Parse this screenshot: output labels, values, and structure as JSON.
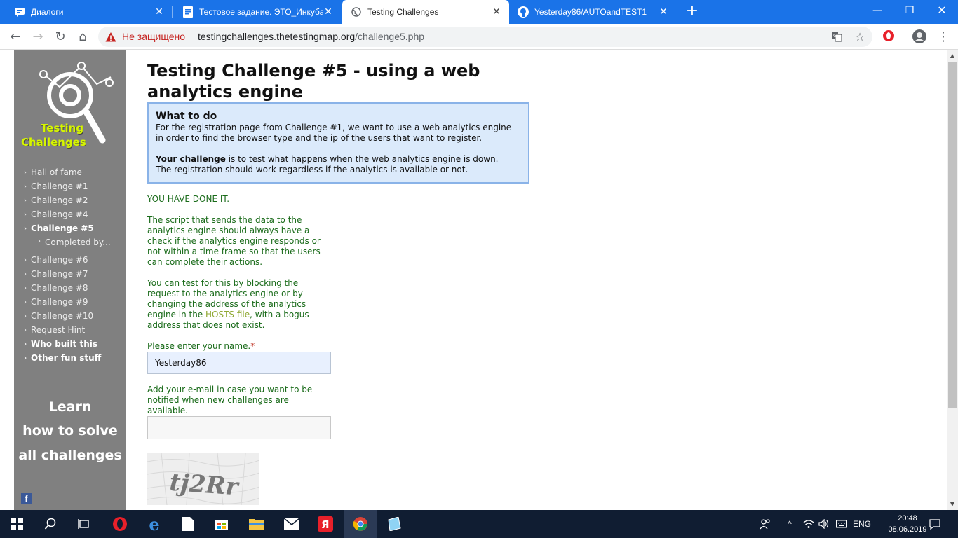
{
  "browser": {
    "tabs": [
      {
        "title": "Диалоги",
        "icon": "vk-chat-icon",
        "active": false
      },
      {
        "title": "Тестовое задание. ЭТО_Инкубатор",
        "icon": "docs-icon",
        "active": false
      },
      {
        "title": "Testing Challenges",
        "icon": "globe-icon",
        "active": true
      },
      {
        "title": "Yesterday86/AUTOandTEST1",
        "icon": "github-icon",
        "active": false
      }
    ],
    "security_label": "Не защищено",
    "url_host": "testingchallenges.thetestingmap.org",
    "url_path": "/challenge5.php"
  },
  "sidebar": {
    "logo_line1": "Testing",
    "logo_line2": "Challenges",
    "menu": [
      {
        "label": "Hall of fame"
      },
      {
        "label": "Challenge #1"
      },
      {
        "label": "Challenge #2"
      },
      {
        "label": "Challenge #4"
      },
      {
        "label": "Challenge #5"
      },
      {
        "label": "Completed by..."
      },
      {
        "label": "Challenge #6"
      },
      {
        "label": "Challenge #7"
      },
      {
        "label": "Challenge #8"
      },
      {
        "label": "Challenge #9"
      },
      {
        "label": "Challenge #10"
      },
      {
        "label": "Request Hint"
      },
      {
        "label": "Who built this"
      },
      {
        "label": "Other fun stuff"
      }
    ],
    "learn": [
      "Learn",
      "how to solve",
      "all challenges"
    ]
  },
  "main": {
    "title": "Testing Challenge #5 - using a web analytics engine",
    "todo": {
      "heading": "What to do",
      "text1": "For the registration page from Challenge #1, we want to use a web analytics engine in order to find the browser type and the ip of the users that want to register.",
      "challenge_strong": "Your challenge",
      "challenge_rest": " is to test what happens when the web analytics engine is down.",
      "text3": "The registration should work regardless if the analytics is available or not."
    },
    "done": "YOU HAVE DONE IT.",
    "para1": "The script that sends the data to the analytics engine should always have a check if the analytics engine responds or not within a time frame so that the users can complete their actions.",
    "para2_before": "You can test for this by blocking the request to the analytics engine or by changing the address of the analytics engine in the ",
    "para2_link": "HOSTS file",
    "para2_after": ", with a bogus address that does not exist.",
    "name_label": "Please enter your name.",
    "name_required": "*",
    "name_value": "Yesterday86",
    "email_label": "Add your e-mail in case you want to be notified when new challenges are available.",
    "email_value": "",
    "captcha_text": "tj2Rr"
  },
  "taskbar": {
    "lang": "ENG",
    "time": "20:48",
    "date": "08.06.2019"
  },
  "colors": {
    "chrome_blue": "#1a73e8",
    "sidebar_gray": "#808080",
    "logo_green": "#d6f500",
    "content_green": "#1a6b1a",
    "box_blue": "#dbeafb",
    "taskbar": "#101d32"
  }
}
